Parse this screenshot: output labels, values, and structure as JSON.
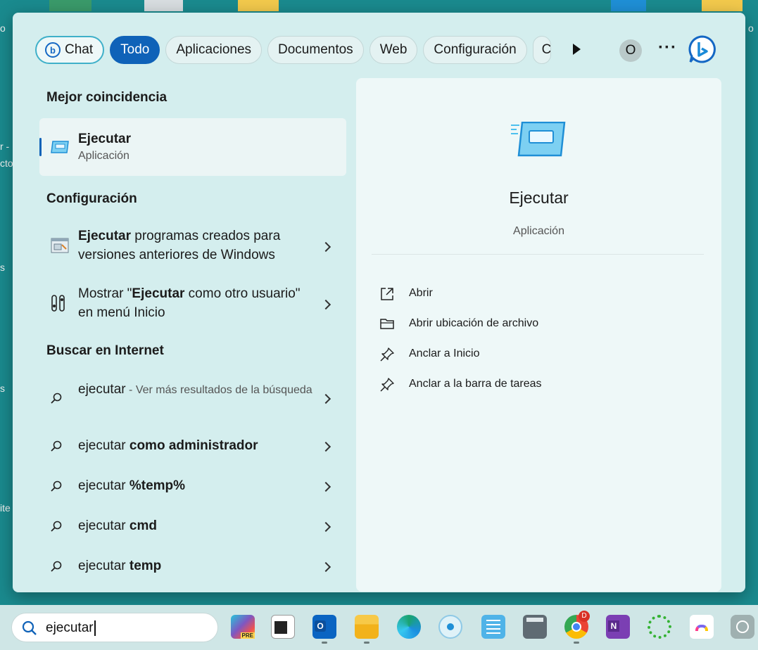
{
  "filters": [
    {
      "label": "Chat",
      "name": "filter-chat"
    },
    {
      "label": "Todo",
      "name": "filter-todo",
      "active": true
    },
    {
      "label": "Aplicaciones",
      "name": "filter-apps"
    },
    {
      "label": "Documentos",
      "name": "filter-docs"
    },
    {
      "label": "Web",
      "name": "filter-web"
    },
    {
      "label": "Configuración",
      "name": "filter-settings"
    },
    {
      "label": "C",
      "name": "filter-more-cut"
    }
  ],
  "header": {
    "avatar_initial": "O",
    "more_label": "···"
  },
  "best_match": {
    "heading": "Mejor coincidencia",
    "title": "Ejecutar",
    "subtitle": "Aplicación"
  },
  "settings": {
    "heading": "Configuración",
    "items": [
      {
        "bold": "Ejecutar",
        "rest": " programas creados para versiones anteriores de Windows"
      },
      {
        "pre": "Mostrar \"",
        "bold": "Ejecutar",
        "rest": " como otro usuario\" en menú Inicio"
      }
    ]
  },
  "web": {
    "heading": "Buscar en Internet",
    "first": {
      "query": "ejecutar",
      "suffix": " - Ver más resultados de la búsqueda"
    },
    "items": [
      {
        "query": "ejecutar ",
        "bold": "como administrador"
      },
      {
        "query": "ejecutar ",
        "bold": "%temp%"
      },
      {
        "query": "ejecutar ",
        "bold": "cmd"
      },
      {
        "query": "ejecutar ",
        "bold": "temp"
      }
    ]
  },
  "preview": {
    "title": "Ejecutar",
    "subtitle": "Aplicación",
    "actions": [
      {
        "label": "Abrir",
        "icon": "open-external-icon"
      },
      {
        "label": "Abrir ubicación de archivo",
        "icon": "folder-icon"
      },
      {
        "label": "Anclar a Inicio",
        "icon": "pin-icon"
      },
      {
        "label": "Anclar a la barra de tareas",
        "icon": "pin-icon"
      }
    ]
  },
  "taskbar": {
    "search_value": "ejecutar",
    "chrome_badge": "D",
    "apps": [
      "copilot-icon",
      "terminal-icon",
      "outlook-icon",
      "file-explorer-icon",
      "edge-icon",
      "cortana-icon",
      "notepad-icon",
      "calculator-icon",
      "chrome-icon",
      "onenote-icon",
      "ring-app-icon",
      "clickup-icon",
      "chatgpt-icon"
    ]
  },
  "desktop": {
    "edge_snippets": [
      "o",
      "r -",
      "cto",
      "s",
      "s",
      "ite",
      "o"
    ]
  },
  "colors": {
    "accent": "#0f62b8",
    "panel": "#d4eeee",
    "preview_pane": "#eef8f8",
    "desktop": "#1a8a8e"
  }
}
